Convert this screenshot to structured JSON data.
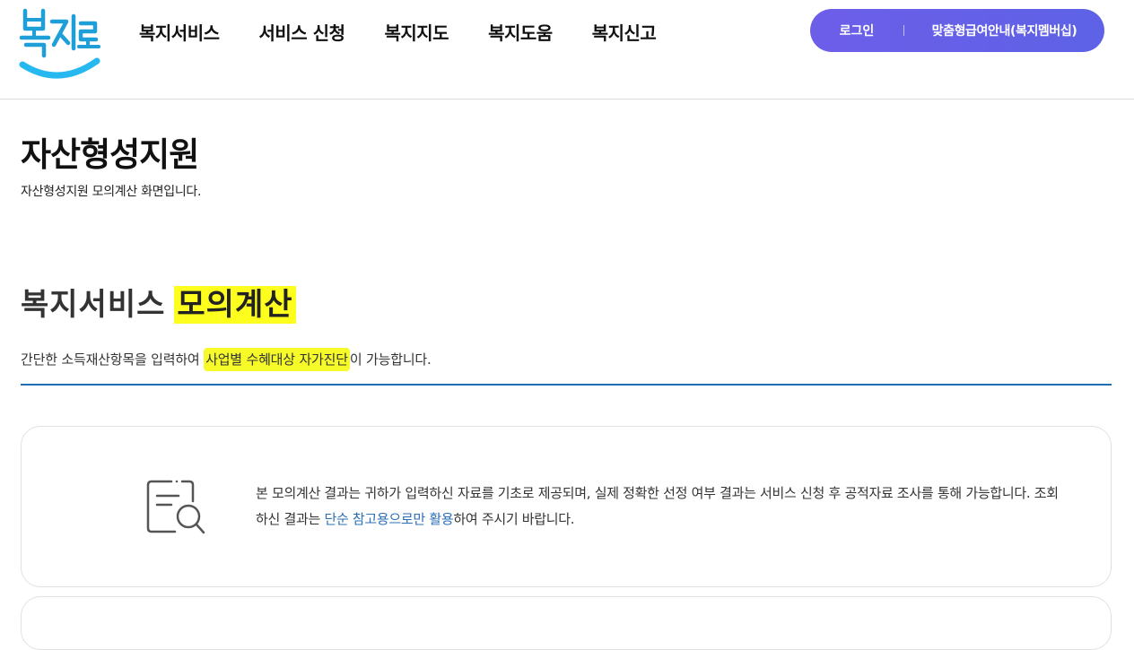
{
  "logo": {
    "text": "복지로",
    "colors": {
      "text": "#1e9fd8",
      "smile": "#27b8f0"
    }
  },
  "nav": {
    "items": [
      "복지서비스",
      "서비스 신청",
      "복지지도",
      "복지도움",
      "복지신고"
    ]
  },
  "top_buttons": {
    "login": "로그인",
    "membership": "맞춤형급여안내(복지멤버십)",
    "color": "#6d5ee8"
  },
  "page": {
    "title": "자산형성지원",
    "description": "자산형성지원 모의계산 화면입니다."
  },
  "section": {
    "title_prefix": "복지서비스",
    "title_highlight": "모의계산",
    "subtitle_before": "간단한 소득재산항목을 입력하여 ",
    "subtitle_highlight": "사업별 수혜대상 자가진단",
    "subtitle_after": "이 가능합니다.",
    "highlight_color": "#fdfd1e",
    "divider_color": "#1d6fb3"
  },
  "notice": {
    "icon": "document-search-icon",
    "text_before": "본 모의계산 결과는 귀하가 입력하신 자료를 기초로 제공되며, 실제 정확한 선정 여부 결과는 서비스 신청 후 공적자료 조사를 통해 가능합니다. 조회하신 결과는 ",
    "text_link": "단순 참고용으로만 활용",
    "text_after": "하여 주시기 바랍니다.",
    "link_color": "#2b6fb6"
  }
}
